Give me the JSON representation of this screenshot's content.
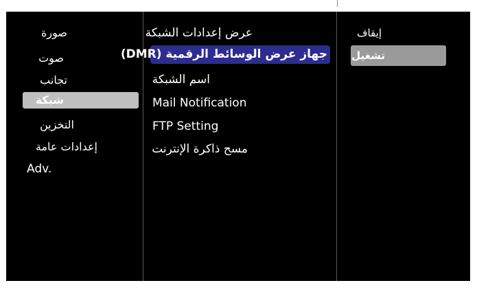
{
  "menu": {
    "categories": [
      {
        "label": "صورة"
      },
      {
        "label": "صوت"
      },
      {
        "label": "تجانب"
      },
      {
        "label": "شبكة",
        "selected": true
      },
      {
        "label": "التخزين"
      },
      {
        "label": "إعدادات عامة"
      },
      {
        "label": "Adv."
      }
    ],
    "network_options": [
      {
        "label": "عرض إعدادات الشبكة"
      },
      {
        "label": "جهاز عرض الوسائط الرقمية (DMR)",
        "selected": true
      },
      {
        "label": "اسم الشبكة"
      },
      {
        "label": "Mail Notification"
      },
      {
        "label": "FTP Setting"
      },
      {
        "label": "مسح ذاكرة الإنترنت"
      }
    ],
    "values": [
      {
        "label": "إيقاف"
      },
      {
        "label": "تشغيل",
        "selected": true
      }
    ]
  },
  "colors": {
    "background": "#000000",
    "category_highlight": "#bfbfbf",
    "option_highlight": "#2c2d8e",
    "value_highlight": "#9a9a9a",
    "text": "#ffffff"
  }
}
